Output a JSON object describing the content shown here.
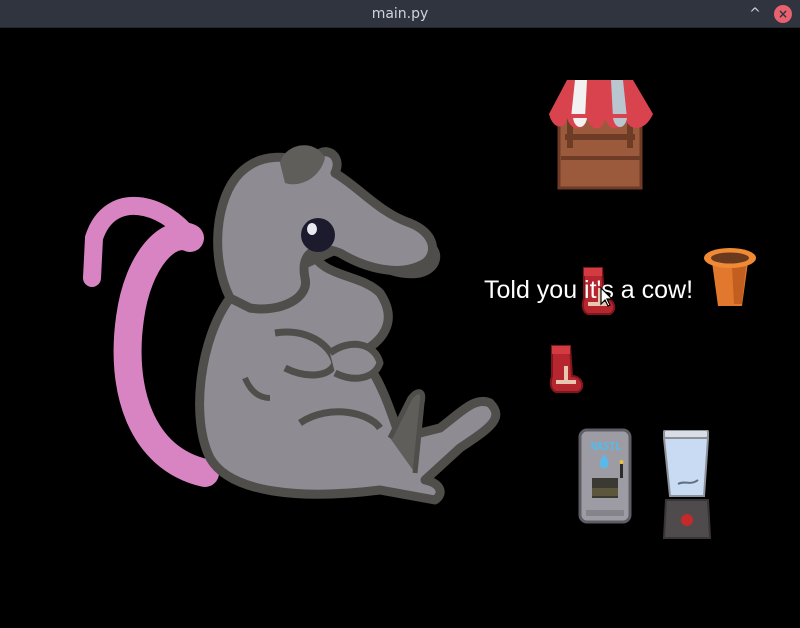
{
  "window": {
    "title": "main.py",
    "minimize_glyph": "^",
    "close_glyph": "×"
  },
  "game": {
    "message": "Told you it's a cow!",
    "dispenser_label": "NASTL",
    "sprites": [
      {
        "name": "rat-sprite"
      },
      {
        "name": "market-stall-sprite"
      },
      {
        "name": "flower-pot-sprite"
      },
      {
        "name": "sock-item"
      },
      {
        "name": "sock-item"
      },
      {
        "name": "water-dispenser-sprite"
      },
      {
        "name": "blender-sprite"
      }
    ]
  },
  "colors": {
    "background": "#000000",
    "titlebar": "#2f343f",
    "rat_body": "#8e8b92",
    "rat_outline": "#4f4e4a",
    "rat_tail": "#d884c3",
    "stall_red": "#d9434d",
    "stall_wood": "#9c5a3c",
    "pot_orange": "#e2782d",
    "sock_red": "#b5262f",
    "dispenser_gray": "#9d9ca4",
    "blender_glass": "#c9dbf2"
  }
}
